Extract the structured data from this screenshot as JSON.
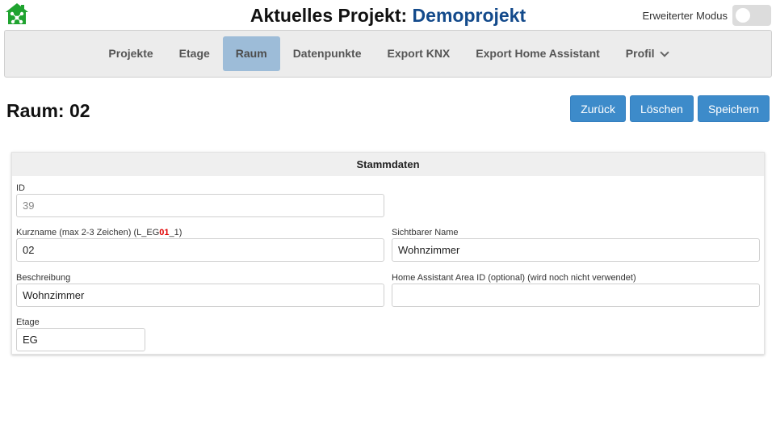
{
  "header": {
    "title_prefix": "Aktuelles Projekt:",
    "project_name": "Demoprojekt",
    "mode_label": "Erweiterter Modus",
    "mode_enabled": false,
    "logo_icon": "house-network-icon",
    "brand_color": "#134a8b",
    "logo_color": "#1fa32f"
  },
  "nav": {
    "items": [
      {
        "label": "Projekte",
        "active": false
      },
      {
        "label": "Etage",
        "active": false
      },
      {
        "label": "Raum",
        "active": true
      },
      {
        "label": "Datenpunkte",
        "active": false
      },
      {
        "label": "Export KNX",
        "active": false
      },
      {
        "label": "Export Home Assistant",
        "active": false
      },
      {
        "label": "Profil",
        "active": false,
        "dropdown": true
      }
    ]
  },
  "page": {
    "title": "Raum: 02",
    "buttons": {
      "back": "Zurück",
      "delete": "Löschen",
      "save": "Speichern"
    },
    "button_color": "#3d8bca"
  },
  "card": {
    "title": "Stammdaten",
    "fields": {
      "id": {
        "label": "ID",
        "value": "39"
      },
      "shortname": {
        "label_before": "Kurzname (max 2-3 Zeichen) (L_EG",
        "label_highlight": "01",
        "label_after": "_1)",
        "value": "02"
      },
      "visible_name": {
        "label": "Sichtbarer Name",
        "value": "Wohnzimmer"
      },
      "description": {
        "label": "Beschreibung",
        "value": "Wohnzimmer"
      },
      "ha_area": {
        "label": "Home Assistant Area ID (optional) (wird noch nicht verwendet)",
        "value": ""
      },
      "floor": {
        "label": "Etage",
        "value": "EG"
      }
    }
  }
}
